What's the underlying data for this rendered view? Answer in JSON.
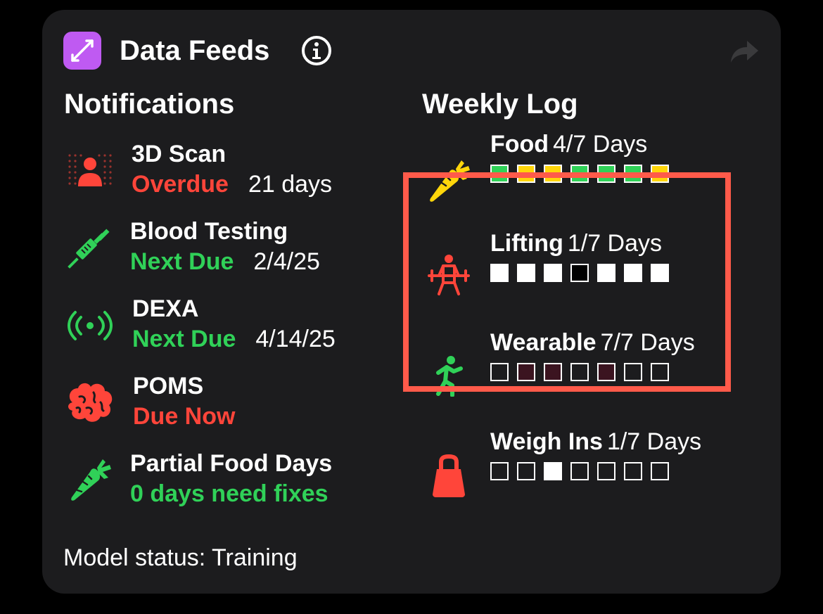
{
  "header": {
    "title": "Data Feeds"
  },
  "notifications": {
    "title": "Notifications",
    "items": [
      {
        "title": "3D Scan",
        "status": "Overdue",
        "when": "21 days",
        "status_color": "#ff453a",
        "icon": "body-scan-icon"
      },
      {
        "title": "Blood Testing",
        "status": "Next Due",
        "when": "2/4/25",
        "status_color": "#30d158",
        "icon": "syringe-icon"
      },
      {
        "title": "DEXA",
        "status": "Next Due",
        "when": "4/14/25",
        "status_color": "#30d158",
        "icon": "broadcast-icon"
      },
      {
        "title": "POMS",
        "status": "Due Now",
        "when": "",
        "status_color": "#ff453a",
        "icon": "brain-icon"
      },
      {
        "title": "Partial Food Days",
        "status": "0 days need fixes",
        "when": "",
        "status_color": "#30d158",
        "icon": "carrot-icon"
      }
    ]
  },
  "weekly_log": {
    "title": "Weekly Log",
    "rows": [
      {
        "label": "Food",
        "days": "4/7 Days",
        "icon": "carrot-icon",
        "squares": [
          "green",
          "yellow",
          "yellow",
          "green",
          "green",
          "green",
          "yellow"
        ]
      },
      {
        "label": "Lifting",
        "days": "1/7 Days",
        "icon": "weightlifter-icon",
        "squares": [
          "white",
          "white",
          "white",
          "black",
          "white",
          "white",
          "white"
        ]
      },
      {
        "label": "Wearable",
        "days": "7/7 Days",
        "icon": "runner-icon",
        "squares": [
          "empty",
          "maroon",
          "maroon",
          "empty",
          "maroon",
          "empty",
          "empty"
        ]
      },
      {
        "label": "Weigh Ins",
        "days": "1/7 Days",
        "icon": "kettlebell-icon",
        "squares": [
          "empty",
          "empty",
          "white",
          "empty",
          "empty",
          "empty",
          "empty"
        ]
      }
    ]
  },
  "footer": {
    "status_text": "Model status: Training"
  },
  "colors": {
    "card": "#1c1c1e",
    "accent": "#bf5af2",
    "red": "#ff453a",
    "green": "#30d158",
    "yellow": "#ffd60a",
    "highlight": "#ff5a4a"
  }
}
